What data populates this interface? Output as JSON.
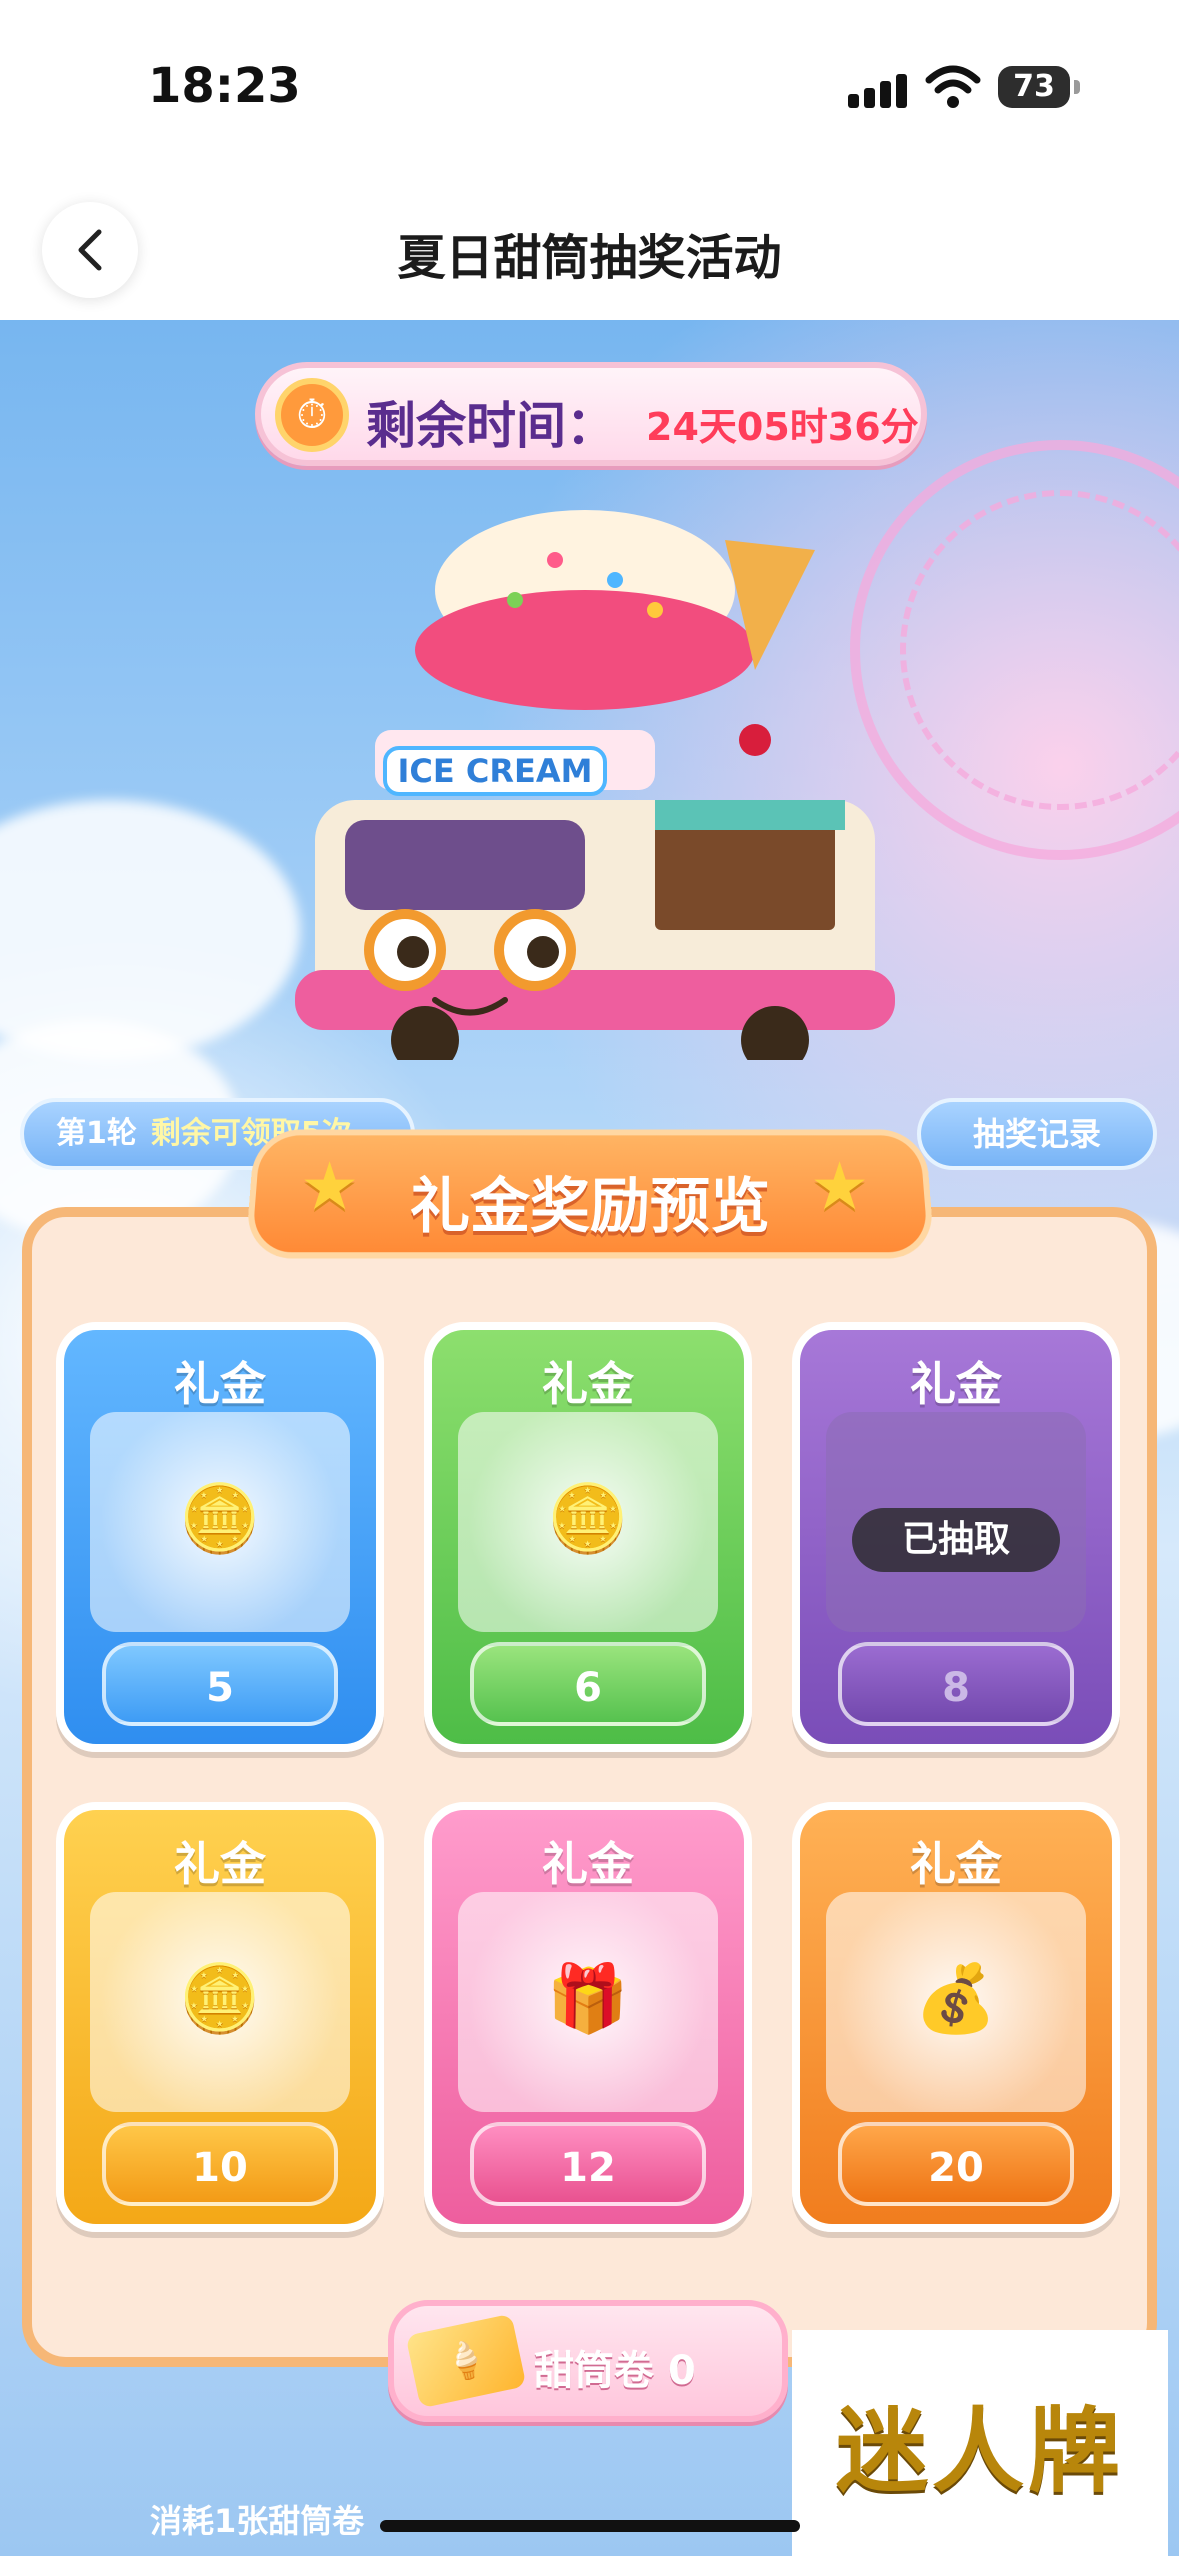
{
  "status_bar": {
    "time": "18:23",
    "battery": "73"
  },
  "nav": {
    "title": "夏日甜筒抽奖活动"
  },
  "timer": {
    "label": "剩余时间：",
    "value": "24天05时36分"
  },
  "truck_sign": "ICE CREAM",
  "round": {
    "label": "第1轮",
    "remaining": "剩余可领取5次"
  },
  "record_button": "抽奖记录",
  "section_title": "礼金奖励预览",
  "cards": [
    {
      "label": "礼金",
      "amount": "5",
      "color": "blue",
      "icon": "coin-icon",
      "drawn": false
    },
    {
      "label": "礼金",
      "amount": "6",
      "color": "green",
      "icon": "coins-icon",
      "drawn": false
    },
    {
      "label": "礼金",
      "amount": "8",
      "color": "purple",
      "icon": "coins-icon",
      "drawn": true,
      "drawn_label": "已抽取"
    },
    {
      "label": "礼金",
      "amount": "10",
      "color": "yellow",
      "icon": "coin-pile-icon",
      "drawn": false
    },
    {
      "label": "礼金",
      "amount": "12",
      "color": "pink",
      "icon": "treasure-chest-icon",
      "drawn": false
    },
    {
      "label": "礼金",
      "amount": "20",
      "color": "orange",
      "icon": "treasure-chest-icon",
      "drawn": false
    }
  ],
  "ticket": {
    "label": "甜筒卷",
    "count": "0"
  },
  "bottom": {
    "left_text": "消耗1张甜筒卷"
  },
  "watermark": "迷人牌",
  "colors": {
    "accent_orange": "#ff8a36",
    "timer_text": "#ff3d5a",
    "board_border": "#f6b777"
  }
}
